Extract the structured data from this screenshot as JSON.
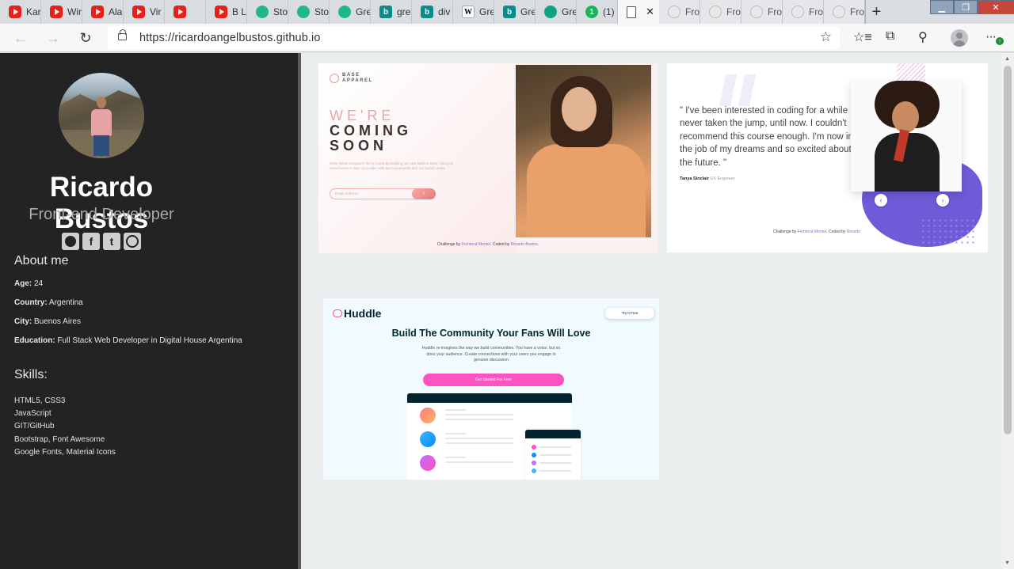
{
  "browser": {
    "tabs": [
      {
        "label": "Kar",
        "icon": "youtube-icon",
        "kind": "yt"
      },
      {
        "label": "Wir",
        "icon": "youtube-icon",
        "kind": "yt"
      },
      {
        "label": "Ala",
        "icon": "youtube-icon",
        "kind": "yt"
      },
      {
        "label": "Vir",
        "icon": "youtube-icon",
        "kind": "yt"
      },
      {
        "label": "",
        "icon": "youtube-audio-icon",
        "kind": "yt"
      },
      {
        "label": "B L",
        "icon": "youtube-icon",
        "kind": "yt"
      },
      {
        "label": "Sto",
        "icon": "frontend-mentor-icon",
        "kind": "fm"
      },
      {
        "label": "Sto",
        "icon": "frontend-mentor-icon",
        "kind": "fm"
      },
      {
        "label": "Gre",
        "icon": "frontend-mentor-icon",
        "kind": "fm"
      },
      {
        "label": "gre",
        "icon": "bing-icon",
        "kind": "bing"
      },
      {
        "label": "div",
        "icon": "bing-icon",
        "kind": "bing"
      },
      {
        "label": "Gre",
        "icon": "wikipedia-icon",
        "kind": "wiki"
      },
      {
        "label": "Gre",
        "icon": "bing-icon",
        "kind": "bing"
      },
      {
        "label": "Gre",
        "icon": "chatgpt-icon",
        "kind": "gpt"
      },
      {
        "label": "(1)",
        "icon": "notification-icon",
        "kind": "one"
      },
      {
        "label": "",
        "icon": "page-icon",
        "kind": "doc",
        "active": true
      },
      {
        "label": "Fro",
        "icon": "loading-icon",
        "kind": "fro"
      },
      {
        "label": "Fro",
        "icon": "loading-icon",
        "kind": "fro"
      },
      {
        "label": "Fro",
        "icon": "loading-icon",
        "kind": "fro"
      },
      {
        "label": "Fro",
        "icon": "loading-icon",
        "kind": "fro"
      },
      {
        "label": "Fro",
        "icon": "loading-icon",
        "kind": "fro"
      }
    ],
    "url": "https://ricardoangelbustos.github.io"
  },
  "profile": {
    "name": "Ricardo Bustos",
    "role": "Front-end Developer",
    "socials": [
      "github-icon",
      "facebook-icon",
      "twitter-icon",
      "instagram-icon"
    ]
  },
  "about": {
    "heading": "About me",
    "age_label": "Age:",
    "age": "24",
    "country_label": "Country:",
    "country": "Argentina",
    "city_label": "City:",
    "city": "Buenos Aires",
    "education_label": "Education:",
    "education": "Full Stack Web Developer in Digital House Argentina"
  },
  "skills": {
    "heading": "Skills:",
    "items": [
      "HTML5, CSS3",
      "JavaScript",
      "GIT/GitHub",
      "Bootstrap, Font Awesome",
      "Google Fonts, Material Icons"
    ]
  },
  "projects": {
    "base_apparel": {
      "logo_line1": "BASE",
      "logo_line2": "APPAREL",
      "heading_light": "WE'RE",
      "heading_dark_1": "COMING",
      "heading_dark_2": "SOON",
      "description": "Hello fellow shoppers! We're currently building our new fashion store. Add your email below to stay up-to-date with announcements and our launch deals.",
      "email_placeholder": "Email Address",
      "submit_glyph": "›",
      "credit_prefix": "Challenge by",
      "credit_fm": "Frontend Mentor",
      "credit_mid": ". Coded by",
      "credit_author": "Ricardo Bustos",
      "credit_end": "."
    },
    "testimonials": {
      "quote": "\" I've been interested in coding for a while but never taken the jump, until now. I couldn't recommend this course enough. I'm now in the job of my dreams and so excited about the future. \"",
      "author": "Tanya Sinclair",
      "author_role": "UX Engineer",
      "prev_glyph": "‹",
      "next_glyph": "›",
      "credit_prefix": "Challenge by",
      "credit_fm": "Frontend Mentor",
      "credit_mid": ". Coded by",
      "credit_author": "Ricardo"
    },
    "huddle": {
      "logo": "Huddle",
      "try_label": "Try It Free",
      "headline": "Build The Community Your Fans Will Love",
      "subtext": "Huddle re-imagines the way we build communities. You have a voice, but so does your audience. Create connections with your users you engage in genuine discussion",
      "cta": "Get Started For Free"
    }
  },
  "colors": {
    "sidebar_bg": "#232323",
    "main_bg": "#ebeeef",
    "huddle_pink": "#ff52c1",
    "testimonial_purple": "#6e5bd8"
  }
}
